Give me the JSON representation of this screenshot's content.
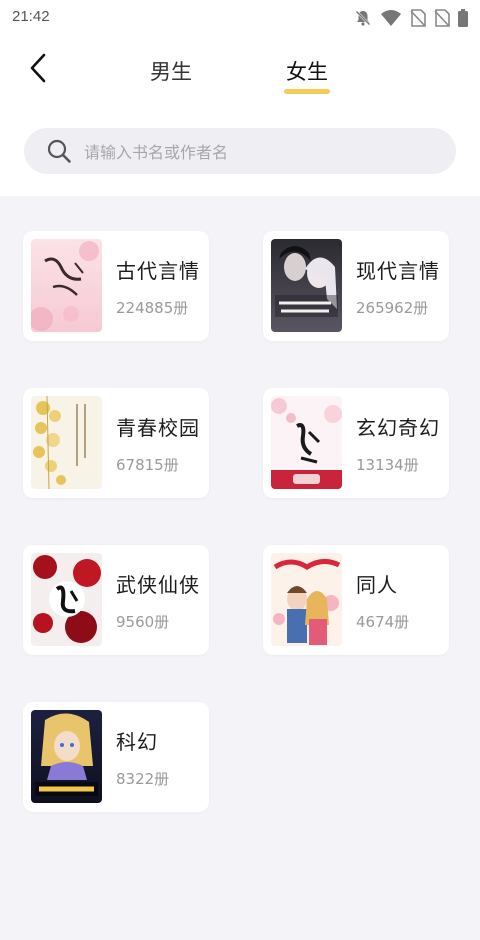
{
  "status_bar": {
    "time": "21:42",
    "icons": [
      "notifications-off-icon",
      "wifi-icon",
      "no-sim-icon",
      "no-sim-icon",
      "battery-icon"
    ]
  },
  "nav": {
    "back_icon": "chevron-left-icon",
    "tabs": [
      {
        "label": "男生",
        "active": false
      },
      {
        "label": "女生",
        "active": true
      }
    ],
    "active_underline_color": "#f0c53c"
  },
  "search": {
    "icon": "search-icon",
    "placeholder": "请输入书名或作者名"
  },
  "categories": [
    {
      "title": "古代言情",
      "count": "224885册"
    },
    {
      "title": "现代言情",
      "count": "265962册"
    },
    {
      "title": "青春校园",
      "count": "67815册"
    },
    {
      "title": "玄幻奇幻",
      "count": "13134册"
    },
    {
      "title": "武侠仙侠",
      "count": "9560册"
    },
    {
      "title": "同人",
      "count": "4674册"
    },
    {
      "title": "科幻",
      "count": "8322册"
    }
  ],
  "colors": {
    "page_background": "#f4f4f8",
    "card_background": "#ffffff",
    "count_text": "#9a9a9a"
  }
}
